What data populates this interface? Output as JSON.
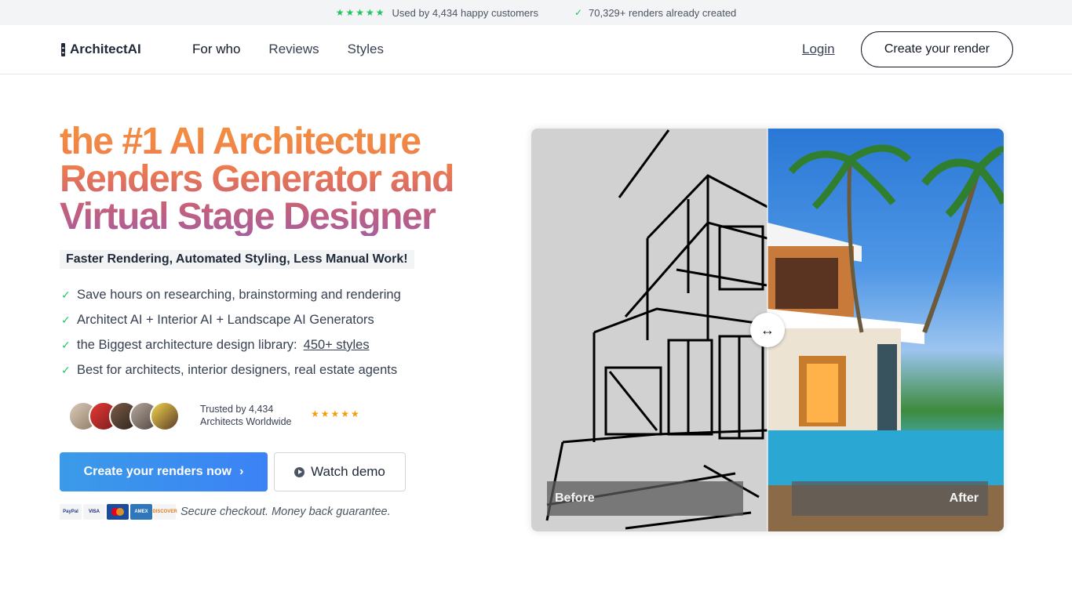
{
  "topbar": {
    "stars": "★★★★★",
    "customers_text": "Used by 4,434 happy customers",
    "renders_text": "70,329+ renders already created"
  },
  "header": {
    "logo": "ArchitectAI",
    "nav": [
      "For who",
      "Reviews",
      "Styles"
    ],
    "login": "Login",
    "cta": "Create your render"
  },
  "hero": {
    "title_line1": "the #1 AI Architecture",
    "title_line2": "Renders Generator and",
    "title_line3": "Virtual Stage Designer",
    "tagline": "Faster Rendering, Automated Styling, Less Manual Work!",
    "bullets": [
      "Save hours on researching, brainstorming and rendering",
      "Architect AI + Interior AI + Landscape AI Generators",
      "the Biggest architecture design library:",
      "Best for architects, interior designers, real estate agents"
    ],
    "styles_link": "450+ styles",
    "trusted_line1": "Trusted by 4,434",
    "trusted_line2": "Architects Worldwide",
    "trust_stars": "★★★★★",
    "primary_button": "Create your renders now",
    "secondary_button": "Watch demo",
    "payments": [
      "PayPal",
      "VISA",
      "Mastercard",
      "AMEX",
      "DISCOVER"
    ],
    "secure_text": "Secure checkout. Money back guarantee."
  },
  "compare": {
    "before_label": "Before",
    "after_label": "After",
    "handle_icon": "↔"
  },
  "colors": {
    "accent_green": "#22c55e",
    "primary_blue": "#3b82f6",
    "star_gold": "#f59e0b"
  }
}
